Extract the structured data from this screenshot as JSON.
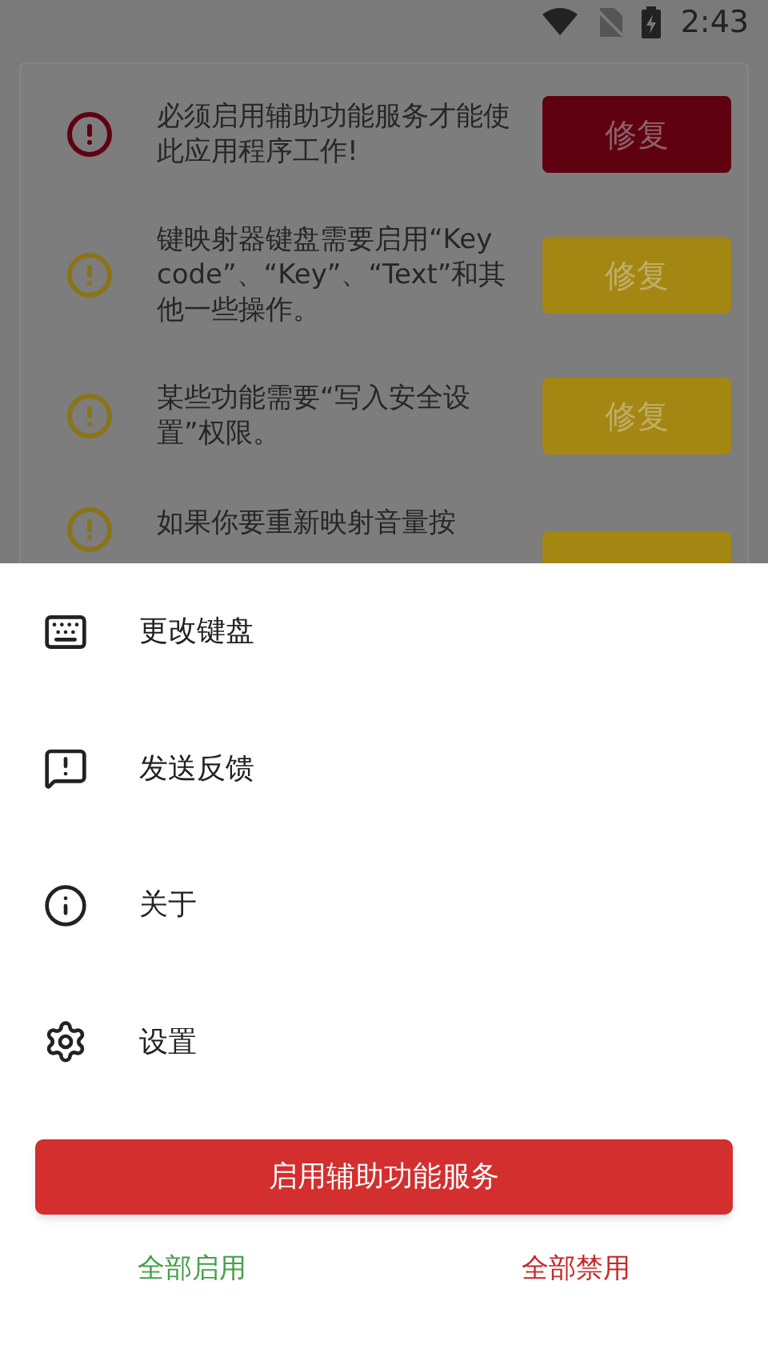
{
  "status_bar": {
    "time": "2:43"
  },
  "issues": [
    {
      "kind": "error",
      "text": "必须启用辅助功能服务才能使此应用程序工作!",
      "button": "修复"
    },
    {
      "kind": "warning",
      "text": "键映射器键盘需要启用“Key code”、“Key”、“Text”和其他一些操作。",
      "button": "修复"
    },
    {
      "kind": "warning",
      "text": "某些功能需要“写入安全设置”权限。",
      "button": "修复"
    },
    {
      "kind": "warning",
      "text": "如果你要重新映射音量按"
    }
  ],
  "menu": [
    {
      "kind": "keyboard",
      "label": "更改键盘"
    },
    {
      "kind": "feedback",
      "label": "发送反馈"
    },
    {
      "kind": "info",
      "label": "关于"
    },
    {
      "kind": "settings",
      "label": "设置"
    }
  ],
  "primary_button": "启用辅助功能服务",
  "actions": [
    {
      "kind": "enable",
      "label": "全部启用"
    },
    {
      "kind": "disable",
      "label": "全部禁用"
    }
  ]
}
